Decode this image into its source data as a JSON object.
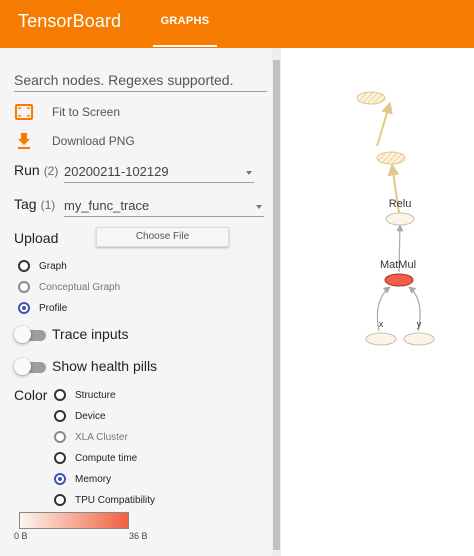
{
  "header": {
    "app_title": "TensorBoard",
    "tabs": [
      {
        "label": "GRAPHS",
        "active": true
      }
    ],
    "background_color": "#f57c00"
  },
  "sidebar": {
    "search": {
      "placeholder": "Search nodes. Regexes supported.",
      "value": ""
    },
    "actions": {
      "fit_to_screen": {
        "label": "Fit to Screen",
        "icon": "fit-screen-icon"
      },
      "download_png": {
        "label": "Download PNG",
        "icon": "download-icon"
      }
    },
    "run": {
      "label": "Run",
      "count": "(2)",
      "value": "20200211-102129"
    },
    "tag": {
      "label": "Tag",
      "count": "(1)",
      "value": "my_func_trace"
    },
    "upload": {
      "label": "Upload",
      "button_label": "Choose File"
    },
    "graph_type": {
      "options": [
        {
          "label": "Graph",
          "checked": false,
          "disabled": false
        },
        {
          "label": "Conceptual Graph",
          "checked": false,
          "disabled": true
        },
        {
          "label": "Profile",
          "checked": true,
          "disabled": false
        }
      ]
    },
    "toggles": {
      "trace_inputs": {
        "label": "Trace inputs",
        "on": false
      },
      "health_pills": {
        "label": "Show health pills",
        "on": false
      }
    },
    "color": {
      "label": "Color",
      "options": [
        {
          "label": "Structure",
          "checked": false,
          "disabled": false
        },
        {
          "label": "Device",
          "checked": false,
          "disabled": false
        },
        {
          "label": "XLA Cluster",
          "checked": false,
          "disabled": true
        },
        {
          "label": "Compute time",
          "checked": false,
          "disabled": false
        },
        {
          "label": "Memory",
          "checked": true,
          "disabled": false
        },
        {
          "label": "TPU Compatibility",
          "checked": false,
          "disabled": false
        }
      ],
      "legend": {
        "min": "0 B",
        "max": "36 B",
        "gradient_start": "#fff5f0",
        "gradient_end": "#f06040"
      }
    },
    "accent_color": "#3f51b5"
  },
  "graph": {
    "nodes": {
      "relu": {
        "label": "Relu"
      },
      "matmul": {
        "label": "MatMul",
        "fill": "#f06048"
      },
      "x": {
        "label": "x"
      },
      "y": {
        "label": "y"
      }
    }
  }
}
